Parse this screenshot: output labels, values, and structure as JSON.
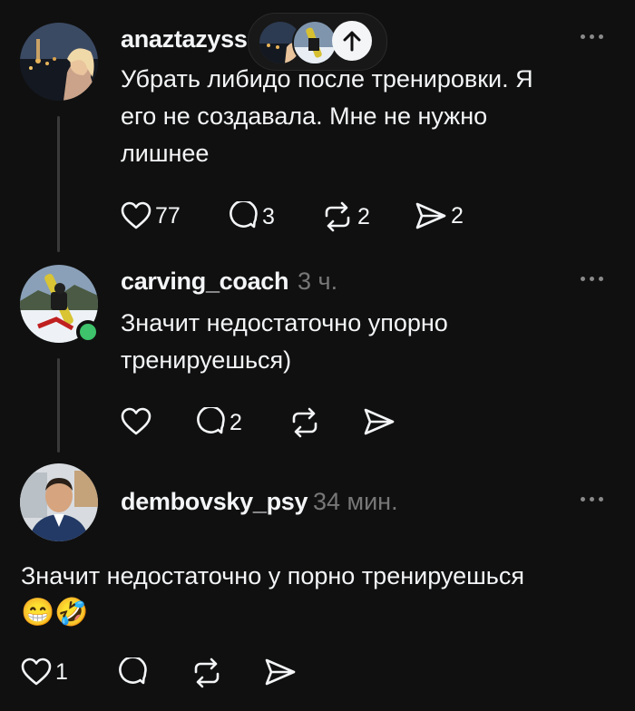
{
  "colors": {
    "background": "#101010",
    "text": "#f3f5f7",
    "muted": "#777777",
    "online": "#3ec26b"
  },
  "header_pill": {
    "scroll_top_icon": "arrow-up-icon"
  },
  "posts": [
    {
      "username": "anaztazyss",
      "time": "",
      "text_lines": [
        "Убрать либидо после тренировки. Я",
        "его не создавала. Мне не нужно",
        "лишнее"
      ],
      "likes": "77",
      "replies": "3",
      "reposts": "2",
      "shares": "2"
    },
    {
      "username": "carving_coach",
      "time": "3 ч.",
      "text_lines": [
        "Значит недостаточно упорно",
        "тренируешься)"
      ],
      "likes": "",
      "replies": "2",
      "reposts": "",
      "shares": ""
    },
    {
      "username": "dembovsky_psy",
      "time": "34 мин.",
      "text_lines": [
        "Значит недостаточно у порно тренируешься"
      ],
      "emoji": "😁🤣",
      "likes": "1",
      "replies": "",
      "reposts": "",
      "shares": ""
    }
  ]
}
